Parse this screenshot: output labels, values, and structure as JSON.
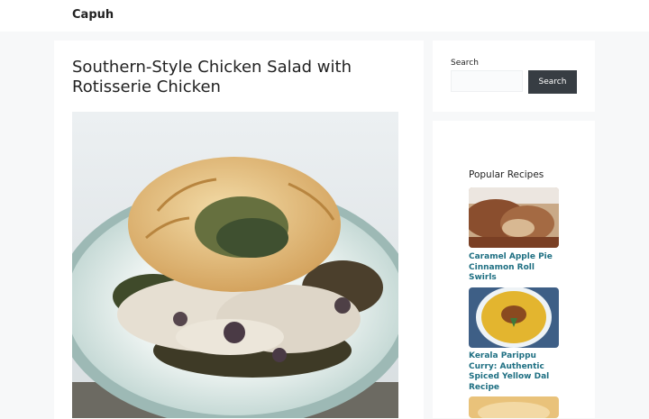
{
  "header": {
    "site_title": "Capuh"
  },
  "post": {
    "title": "Southern-Style Chicken Salad with Rotisserie Chicken"
  },
  "search": {
    "label": "Search",
    "placeholder": "",
    "value": "",
    "button_label": "Search"
  },
  "sidebar": {
    "heading": "Popular Recipes",
    "recipes": [
      {
        "title": "Caramel Apple Pie Cinnamon Roll Swirls"
      },
      {
        "title": "Kerala Parippu Curry: Authentic Spiced Yellow Dal Recipe"
      }
    ]
  }
}
